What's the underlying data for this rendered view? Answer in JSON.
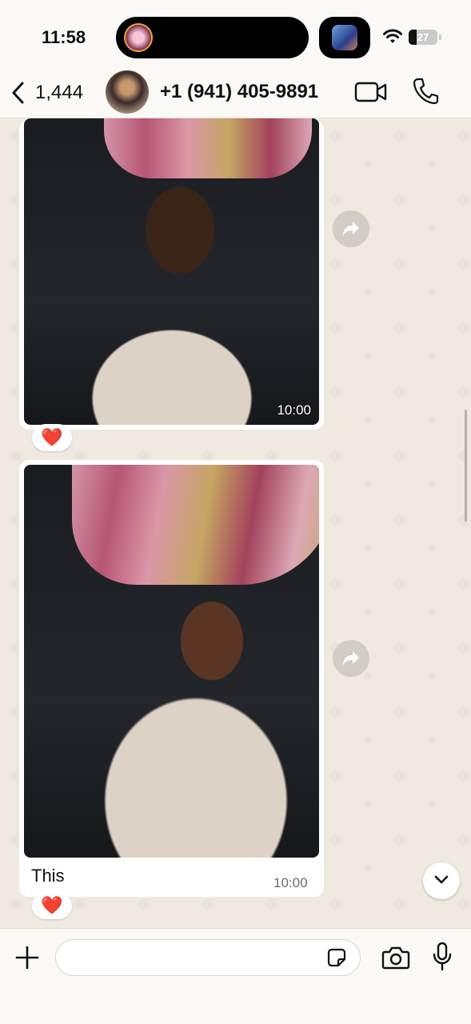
{
  "status_bar": {
    "time": "11:58",
    "battery": "27",
    "battery_level": 0.27
  },
  "header": {
    "back_count": "1,444",
    "contact_name": "+1 (941) 405-9891",
    "icons": [
      "chevron-left-icon",
      "video-call-icon",
      "phone-icon"
    ]
  },
  "messages": [
    {
      "type": "image",
      "time": "10:00",
      "reaction": "❤️"
    },
    {
      "type": "image",
      "caption": "This",
      "time": "10:00",
      "reaction": "❤️"
    }
  ],
  "input": {
    "placeholder": "",
    "value": ""
  },
  "colors": {
    "background": "#efeae2",
    "bubble": "#ffffff",
    "heart": "#e0242f"
  }
}
